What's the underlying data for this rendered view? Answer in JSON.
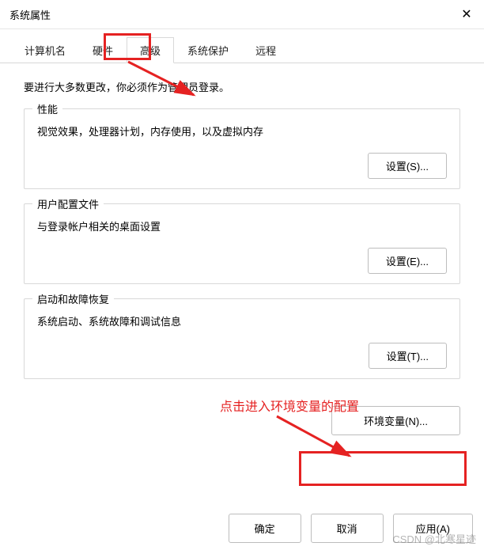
{
  "window": {
    "title": "系统属性",
    "close_icon": "✕"
  },
  "tabs": {
    "items": [
      "计算机名",
      "硬件",
      "高级",
      "系统保护",
      "远程"
    ],
    "active_index": 2
  },
  "intro": "要进行大多数更改，你必须作为管理员登录。",
  "groups": {
    "performance": {
      "title": "性能",
      "desc": "视觉效果，处理器计划，内存使用，以及虚拟内存",
      "button": "设置(S)..."
    },
    "userprofile": {
      "title": "用户配置文件",
      "desc": "与登录帐户相关的桌面设置",
      "button": "设置(E)..."
    },
    "startup": {
      "title": "启动和故障恢复",
      "desc": "系统启动、系统故障和调试信息",
      "button": "设置(T)..."
    }
  },
  "env_button": "环境变量(N)...",
  "footer": {
    "ok": "确定",
    "cancel": "取消",
    "apply": "应用(A)"
  },
  "annotations": {
    "text": "点击进入环境变量的配置"
  },
  "watermark": "CSDN @北寒星迹"
}
